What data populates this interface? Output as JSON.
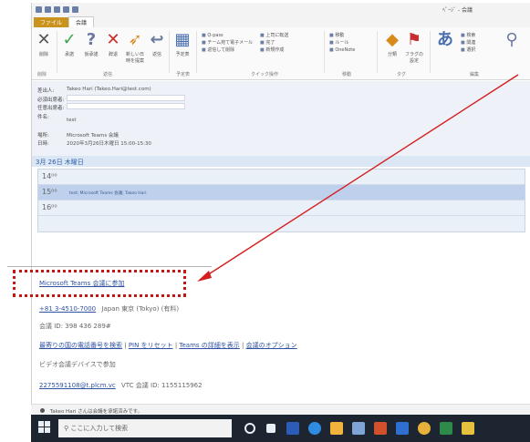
{
  "window": {
    "title": "ﾍﾟｰｼﾞ - 会議"
  },
  "ribbon": {
    "tabs": [
      "ファイル",
      "会議"
    ],
    "buttons": [
      {
        "label": "削除",
        "icon": "delete-x-icon",
        "color": "#555555"
      },
      {
        "label": "承諾",
        "icon": "check-icon",
        "color": "#3aa34a"
      },
      {
        "label": "仮承諾",
        "icon": "question-icon",
        "color": "#6b79a0"
      },
      {
        "label": "辞退",
        "icon": "cross-icon",
        "color": "#c92d2d"
      },
      {
        "label": "新しい日時を提案",
        "icon": "calendar-arrow-icon",
        "color": "#d98a1c"
      },
      {
        "label": "返信",
        "icon": "reply-icon",
        "color": "#6b79a0"
      },
      {
        "label": "予定表",
        "icon": "calendar-icon",
        "color": "#4a6fb0"
      }
    ],
    "quick_steps": [
      "Q-pass",
      "チーム宛て電子メール",
      "返信して削除",
      "上司に転送",
      "完了",
      "新規作成"
    ],
    "move_items": [
      "移動",
      "ルール",
      "OneNote"
    ],
    "tags_items": [
      "分類",
      "フラグの設定"
    ],
    "group_labels": [
      "削除",
      "返信",
      "予定表",
      "クイック操作",
      "移動",
      "タグ",
      "編集"
    ]
  },
  "header": {
    "from_label": "差出人:",
    "from_value": "Takeo Hari (Takeo.Hari@test.com)",
    "required_label": "必須出席者:",
    "optional_label": "任意出席者:",
    "subject_label": "件名:",
    "subject_value": "test",
    "location_label": "場所:",
    "location_value": "Microsoft Teams 会議",
    "time_label": "日時:",
    "time_value": "2020年3月26日木曜日 15:00-15:30"
  },
  "calendar": {
    "day_header": "3月 26日 木曜日",
    "slots": [
      "14⁰⁰",
      "15⁰⁰",
      "16⁰⁰"
    ],
    "event_text": "test; Microsoft Teams 会議; Takeo Hari"
  },
  "body": {
    "join_link": "Microsoft Teams 会議に参加",
    "phone_number": "+81 3-4510-7000",
    "phone_location": "Japan 東京 (Tokyo) (有料)",
    "conference_id": "会議 ID: 398 436 289#",
    "local_numbers": "最寄りの国の電話番号を検索",
    "reset_pin": "PIN をリセット",
    "learn_more": "Teams の詳細を表示",
    "meeting_options": "会議のオプション",
    "video_device": "ビデオ会議デバイスで参加",
    "vtc_address": "2275591108@t.plcm.vc",
    "vtc_id": "VTC 会議 ID: 1155115962"
  },
  "notification": {
    "text": "Takeo Hari さんは会議を承諾済みです。"
  },
  "taskbar": {
    "search_placeholder": "ここに入力して検索",
    "icons": [
      {
        "name": "task-view-icon",
        "color": "#e9eef5"
      },
      {
        "name": "multitask-icon",
        "color": "#e9eef5"
      },
      {
        "name": "word-icon",
        "color": "#2b5db7"
      },
      {
        "name": "edge-icon",
        "color": "#2e8de0"
      },
      {
        "name": "mail-icon",
        "color": "#f0b43c"
      },
      {
        "name": "store-icon",
        "color": "#7fa4d6"
      },
      {
        "name": "powerpoint-icon",
        "color": "#d2502c"
      },
      {
        "name": "outlook-icon",
        "color": "#2f6fd0"
      },
      {
        "name": "chrome-icon",
        "color": "#e8b23a"
      },
      {
        "name": "excel-icon",
        "color": "#2d8a4b"
      },
      {
        "name": "sticky-icon",
        "color": "#e5c13d"
      }
    ]
  }
}
